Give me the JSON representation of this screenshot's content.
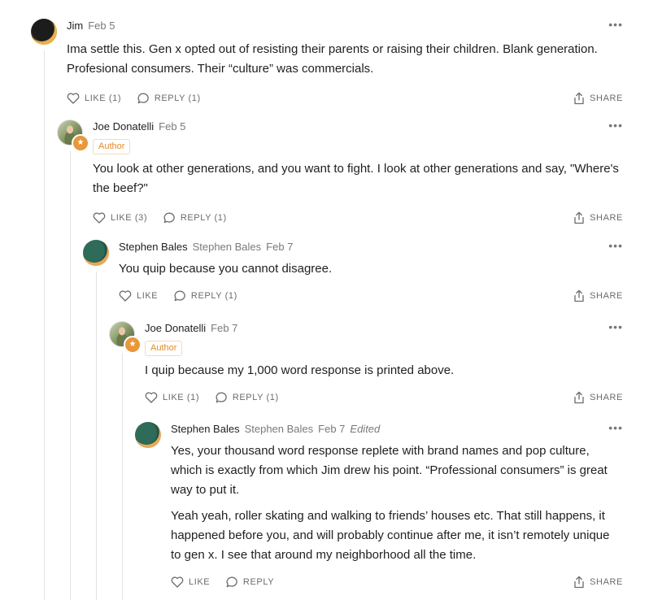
{
  "comments": [
    {
      "name": "Jim",
      "handle": "",
      "date": "Feb 5",
      "badge": "",
      "edited": "",
      "paragraphs": [
        "Ima settle this. Gen x opted out of resisting their parents or raising their children. Blank generation. Profesional consumers. Their “culture” was commercials."
      ],
      "like": "LIKE (1)",
      "reply": "REPLY (1)",
      "share": "SHARE",
      "avatar_icon": "dark-circle-avatar"
    },
    {
      "name": "Joe Donatelli",
      "handle": "",
      "date": "Feb 5",
      "badge": "Author",
      "edited": "",
      "paragraphs": [
        "You look at other generations, and you want to fight. I look at other generations and say, \"Where's the beef?\""
      ],
      "like": "LIKE (3)",
      "reply": "REPLY (1)",
      "share": "SHARE",
      "avatar_icon": "photo-avatar-with-star"
    },
    {
      "name": "Stephen Bales",
      "handle": "Stephen Bales",
      "date": "Feb 7",
      "badge": "",
      "edited": "",
      "paragraphs": [
        "You quip because you cannot disagree."
      ],
      "like": "LIKE",
      "reply": "REPLY (1)",
      "share": "SHARE",
      "avatar_icon": "green-circle-avatar"
    },
    {
      "name": "Joe Donatelli",
      "handle": "",
      "date": "Feb 7",
      "badge": "Author",
      "edited": "",
      "paragraphs": [
        "I quip because my 1,000 word response is printed above."
      ],
      "like": "LIKE (1)",
      "reply": "REPLY (1)",
      "share": "SHARE",
      "avatar_icon": "photo-avatar-with-star"
    },
    {
      "name": "Stephen Bales",
      "handle": "Stephen Bales",
      "date": "Feb 7",
      "badge": "",
      "edited": "Edited",
      "paragraphs": [
        "Yes, your thousand word response replete with brand names and pop culture, which is exactly from which Jim drew his point. “Professional consumers” is great way to put it.",
        "Yeah yeah, roller skating and walking to friends’ houses etc. That still happens, it happened before you, and will probably continue after me, it isn’t remotely unique to gen x. I see that around my neighborhood all the time."
      ],
      "like": "LIKE",
      "reply": "REPLY",
      "share": "SHARE",
      "avatar_icon": "green-circle-avatar"
    }
  ],
  "colors": {
    "author_badge": "#e38b2c",
    "star_badge": "#e8973a",
    "thread_line": "#e3e3e3",
    "muted_text": "#7a7a7a"
  }
}
